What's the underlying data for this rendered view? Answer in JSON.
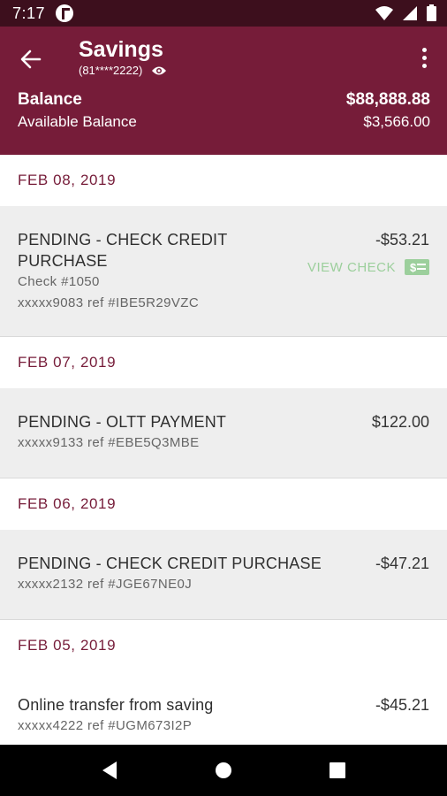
{
  "status_bar": {
    "time": "7:17"
  },
  "header": {
    "title": "Savings",
    "account_number": "(81****2222)",
    "balance_label": "Balance",
    "balance_value": "$88,888.88",
    "available_label": "Available Balance",
    "available_value": "$3,566.00"
  },
  "colors": {
    "header": "#761c39",
    "status": "#3d0f1d",
    "date_text": "#761c39",
    "view_check": "#9ccf9c"
  },
  "groups": [
    {
      "date": "FEB 08, 2019",
      "transactions": [
        {
          "description": "PENDING - CHECK CREDIT PURCHASE",
          "amount": "-$53.21",
          "check": "Check #1050",
          "ref": "xxxxx9083 ref #IBE5R29VZC",
          "action": "VIEW CHECK"
        }
      ]
    },
    {
      "date": "FEB 07, 2019",
      "transactions": [
        {
          "description": "PENDING - OLTT PAYMENT",
          "amount": "$122.00",
          "ref": "xxxxx9133 ref #EBE5Q3MBE"
        }
      ]
    },
    {
      "date": "FEB 06, 2019",
      "transactions": [
        {
          "description": "PENDING - CHECK CREDIT PURCHASE",
          "amount": "-$47.21",
          "ref": "xxxxx2132 ref #JGE67NE0J"
        }
      ]
    },
    {
      "date": "FEB 05, 2019",
      "transactions": [
        {
          "description": "Online transfer from saving",
          "amount": "-$45.21",
          "ref": "xxxxx4222 ref #UGM673I2P"
        }
      ]
    }
  ]
}
